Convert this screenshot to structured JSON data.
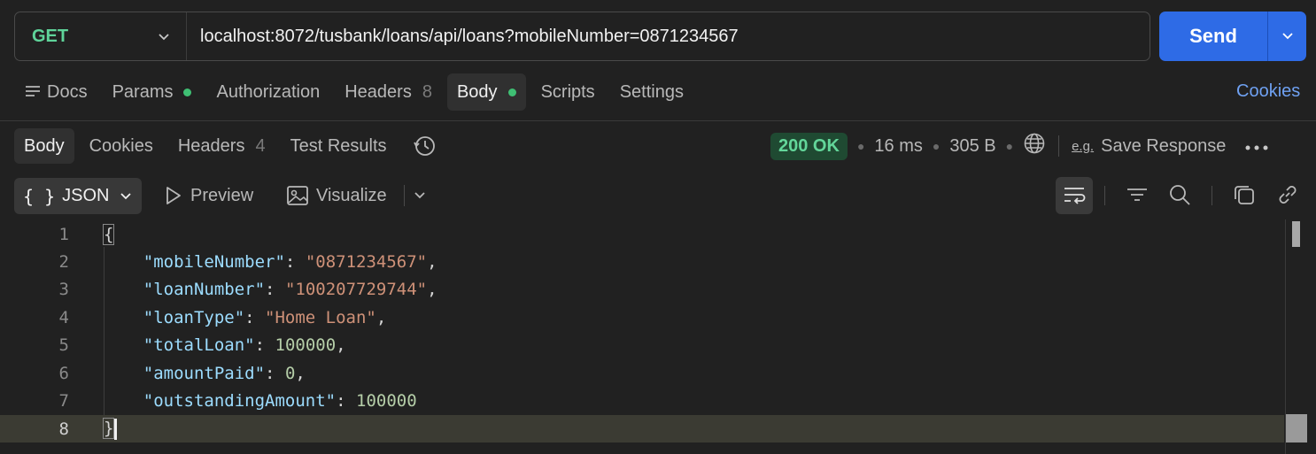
{
  "request": {
    "method": "GET",
    "url": "localhost:8072/tusbank/loans/api/loans?mobileNumber=0871234567",
    "send_label": "Send"
  },
  "request_tabs": {
    "docs": "Docs",
    "params": "Params",
    "authorization": "Authorization",
    "headers": "Headers",
    "headers_count": "8",
    "body": "Body",
    "scripts": "Scripts",
    "settings": "Settings",
    "cookies": "Cookies"
  },
  "response_tabs": {
    "body": "Body",
    "cookies": "Cookies",
    "headers": "Headers",
    "headers_count": "4",
    "test_results": "Test Results"
  },
  "status": {
    "code": "200 OK",
    "time": "16 ms",
    "size": "305 B",
    "save_response": "Save Response"
  },
  "format_toolbar": {
    "format": "JSON",
    "preview": "Preview",
    "visualize": "Visualize"
  },
  "editor": {
    "line_numbers": [
      "1",
      "2",
      "3",
      "4",
      "5",
      "6",
      "7",
      "8"
    ],
    "lines": {
      "open": "{",
      "l2_key": "\"mobileNumber\"",
      "l2_val": "\"0871234567\"",
      "l3_key": "\"loanNumber\"",
      "l3_val": "\"100207729744\"",
      "l4_key": "\"loanType\"",
      "l4_val": "\"Home Loan\"",
      "l5_key": "\"totalLoan\"",
      "l5_val": "100000",
      "l6_key": "\"amountPaid\"",
      "l6_val": "0",
      "l7_key": "\"outstandingAmount\"",
      "l7_val": "100000",
      "close": "}"
    }
  },
  "colors": {
    "accent": "#2e6be6",
    "method": "#5fd49a",
    "status_ok": "#63d69a",
    "json_key": "#9cdcfe",
    "json_string": "#ce9178",
    "json_number": "#b5cea8"
  }
}
